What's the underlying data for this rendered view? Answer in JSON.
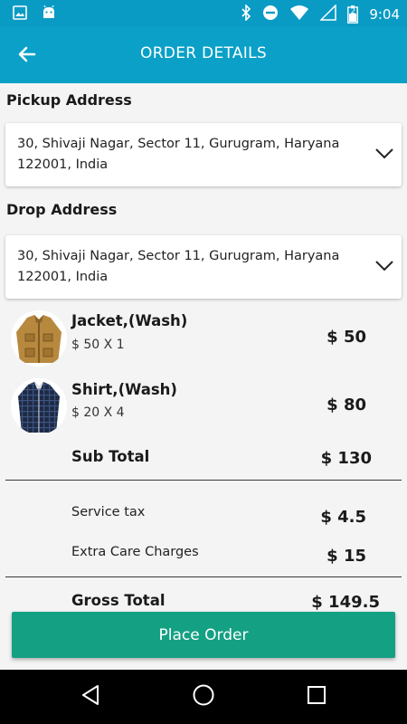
{
  "status_bar": {
    "time": "9:04",
    "battery": "2",
    "left_icons": [
      "image-icon",
      "android-icon"
    ],
    "right_icons": [
      "bluetooth-icon",
      "do-not-disturb-icon",
      "wifi-icon",
      "no-signal-icon",
      "battery-icon"
    ]
  },
  "app_bar": {
    "title": "ORDER DETAILS",
    "back_icon": "arrow-left-icon"
  },
  "pickup": {
    "label": "Pickup Address",
    "address": "30, Shivaji Nagar, Sector 11, Gurugram, Haryana 122001, India"
  },
  "drop": {
    "label": "Drop Address",
    "address": "30, Shivaji Nagar, Sector 11, Gurugram, Haryana 122001, India"
  },
  "items": [
    {
      "name": "Jacket,(Wash)",
      "qty": "$ 50 X 1",
      "price": "$ 50"
    },
    {
      "name": "Shirt,(Wash)",
      "qty": "$ 20 X 4",
      "price": "$ 80"
    }
  ],
  "summary": {
    "subtotal_label": "Sub Total",
    "subtotal_value": "$ 130",
    "service_tax_label": "Service tax",
    "service_tax_value": "$ 4.5",
    "extra_care_label": "Extra Care Charges",
    "extra_care_value": "$ 15",
    "gross_label": "Gross Total",
    "gross_value": "$ 149.5"
  },
  "place_order_label": "Place Order",
  "colors": {
    "app_bar": "#0aa0c8",
    "status_bar": "#0a9bc4",
    "button": "#14a083"
  }
}
